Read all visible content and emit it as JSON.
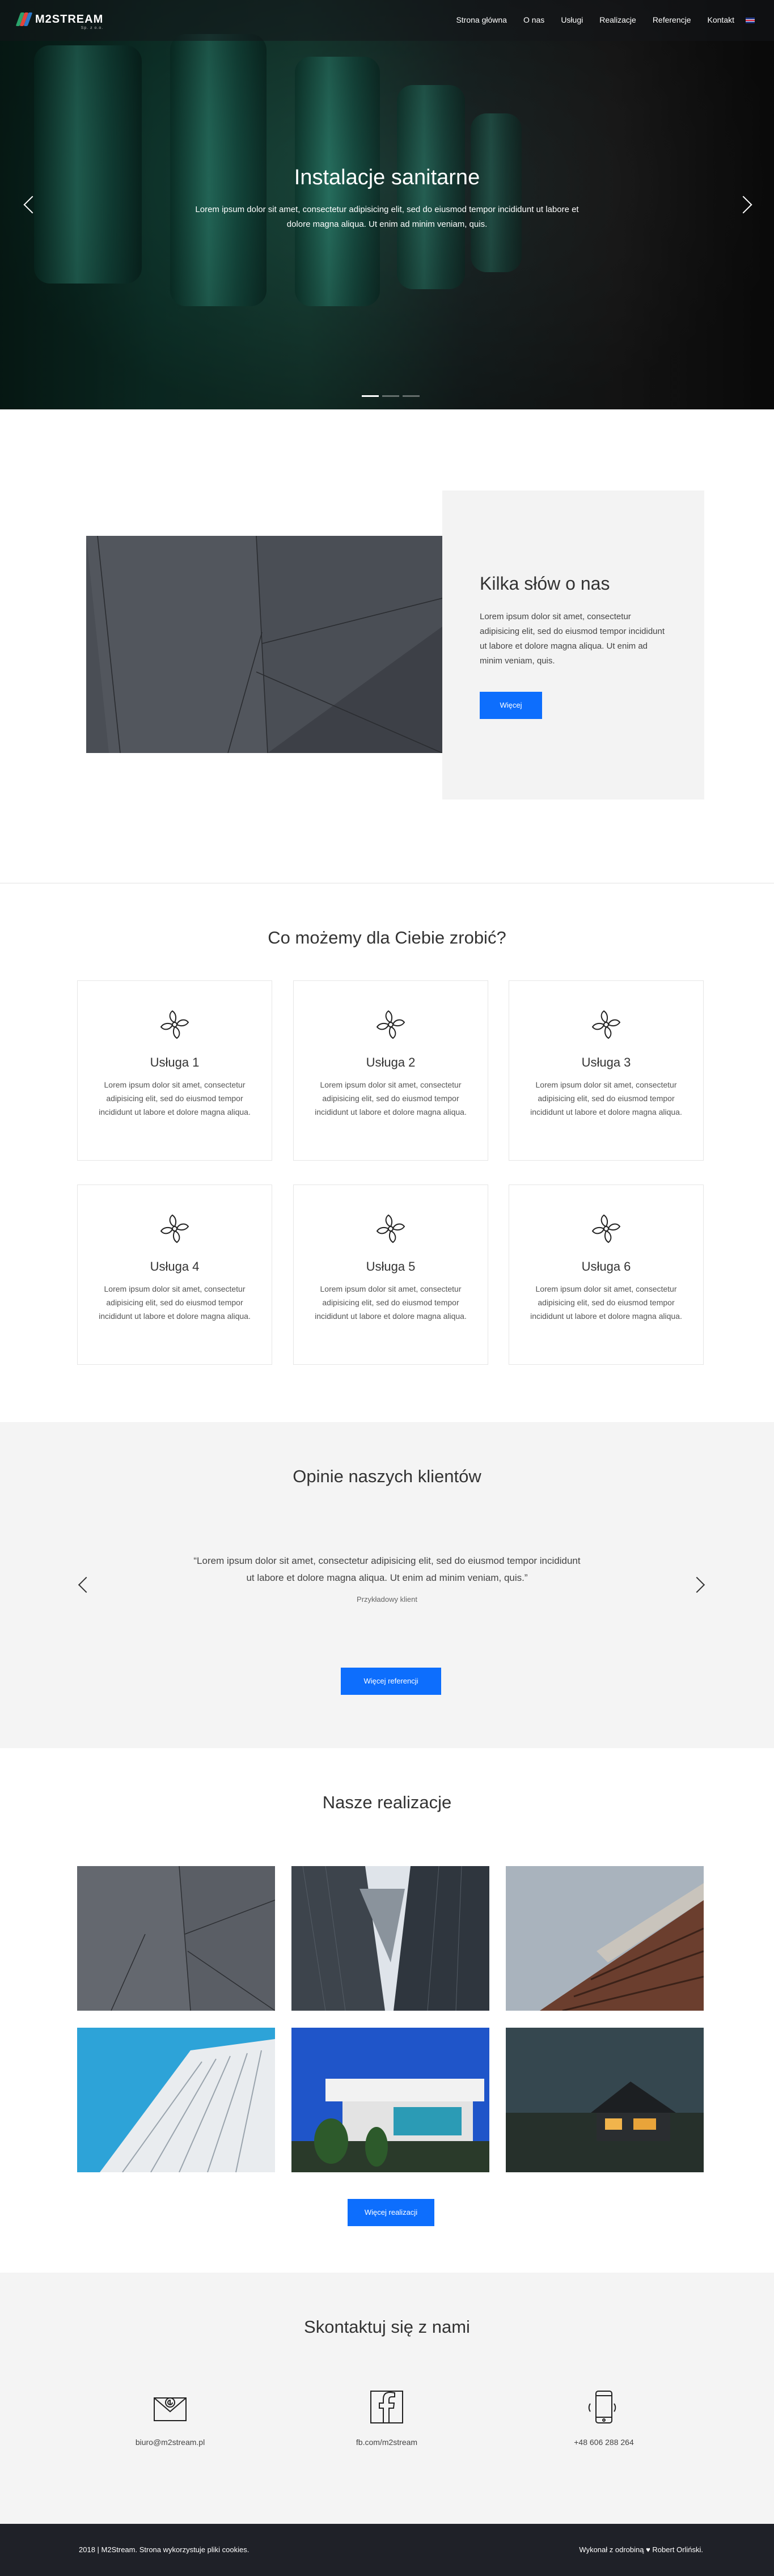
{
  "nav": {
    "logo": "M2STREAM",
    "logo_sub": "Sp. z o.o.",
    "items": [
      "Strona główna",
      "O nas",
      "Usługi",
      "Realizacje",
      "Referencje",
      "Kontakt"
    ],
    "language_icon": "uk-flag-icon"
  },
  "hero": {
    "title": "Instalacje sanitarne",
    "text": "Lorem ipsum dolor sit amet, consectetur adipisicing elit, sed do eiusmod tempor incididunt ut labore et dolore magna aliqua. Ut enim ad minim veniam, quis.",
    "slides": 3,
    "active_slide": 1
  },
  "about": {
    "title": "Kilka słów o nas",
    "text": "Lorem ipsum dolor sit amet, consectetur adipisicing elit, sed do eiusmod tempor incididunt ut labore et dolore magna aliqua. Ut enim ad minim veniam, quis.",
    "button": "Więcej"
  },
  "services": {
    "title": "Co możemy dla Ciebie zrobić?",
    "items": [
      {
        "name": "Usługa 1",
        "text": "Lorem ipsum dolor sit amet, consectetur adipisicing elit, sed do eiusmod tempor incididunt ut labore et dolore magna aliqua."
      },
      {
        "name": "Usługa 2",
        "text": "Lorem ipsum dolor sit amet, consectetur adipisicing elit, sed do eiusmod tempor incididunt ut labore et dolore magna aliqua."
      },
      {
        "name": "Usługa 3",
        "text": "Lorem ipsum dolor sit amet, consectetur adipisicing elit, sed do eiusmod tempor incididunt ut labore et dolore magna aliqua."
      },
      {
        "name": "Usługa 4",
        "text": "Lorem ipsum dolor sit amet, consectetur adipisicing elit, sed do eiusmod tempor incididunt ut labore et dolore magna aliqua."
      },
      {
        "name": "Usługa 5",
        "text": "Lorem ipsum dolor sit amet, consectetur adipisicing elit, sed do eiusmod tempor incididunt ut labore et dolore magna aliqua."
      },
      {
        "name": "Usługa 6",
        "text": "Lorem ipsum dolor sit amet, consectetur adipisicing elit, sed do eiusmod tempor incididunt ut labore et dolore magna aliqua."
      }
    ],
    "icon": "fan-icon"
  },
  "testimonials": {
    "title": "Opinie naszych klientów",
    "quote": "“Lorem ipsum dolor sit amet, consectetur adipisicing elit, sed do eiusmod tempor incididunt ut labore et dolore magna aliqua. Ut enim ad minim veniam, quis.”",
    "client": "Przykładowy klient",
    "button": "Więcej referencji"
  },
  "realizations": {
    "title": "Nasze realizacje",
    "button": "Więcej realizacji"
  },
  "contact": {
    "title": "Skontaktuj się z nami",
    "email": "biuro@m2stream.pl",
    "facebook": "fb.com/m2stream",
    "phone": "+48 606 288 264"
  },
  "footer": {
    "left": "2018 | M2Stream. Strona wykorzystuje pliki cookies.",
    "right": "Wykonał z odrobiną ♥ Robert Orliński."
  },
  "colors": {
    "accent": "#0d6efd",
    "footer_bg": "#1f2128",
    "section_bg": "#f4f4f4"
  }
}
